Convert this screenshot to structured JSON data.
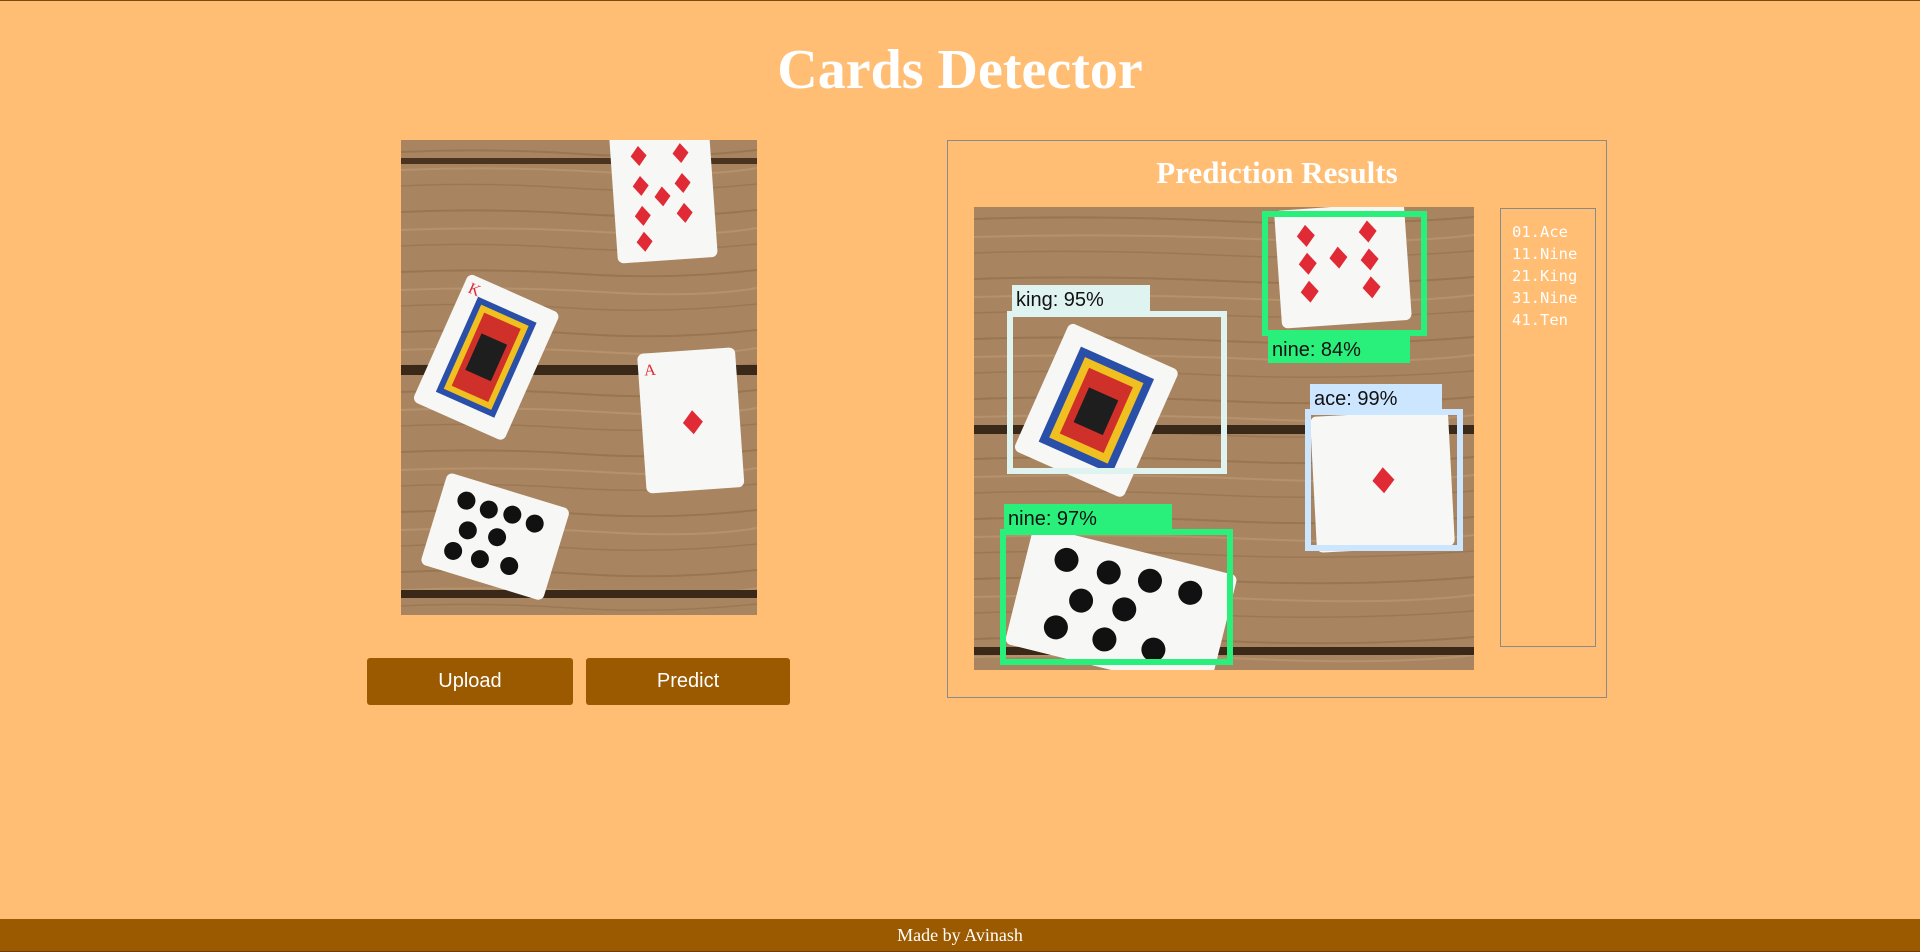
{
  "header": {
    "title": "Cards Detector"
  },
  "input_image": {
    "description_icon": "playing-cards-photo",
    "cards": [
      {
        "rank": "9",
        "suit": "diamonds"
      },
      {
        "rank": "K",
        "suit": "diamonds"
      },
      {
        "rank": "A",
        "suit": "diamonds"
      },
      {
        "rank": "9",
        "suit": "spades"
      }
    ]
  },
  "buttons": {
    "upload_label": "Upload",
    "predict_label": "Predict"
  },
  "results": {
    "title": "Prediction Results",
    "detections": [
      {
        "label": "king: 95%",
        "color": "#dff3f0"
      },
      {
        "label": "nine: 84%",
        "color": "#29f07a"
      },
      {
        "label": "ace: 99%",
        "color": "#cde6ff"
      },
      {
        "label": "nine: 97%",
        "color": "#29f07a"
      }
    ],
    "list": [
      "01.Ace",
      "11.Nine",
      "21.King",
      "31.Nine",
      "41.Ten"
    ]
  },
  "footer": {
    "text": "Made by Avinash"
  },
  "colors": {
    "background": "#ffbe73",
    "button": "#9b5a00",
    "footer": "#9b5a00",
    "text": "#ffffff"
  }
}
